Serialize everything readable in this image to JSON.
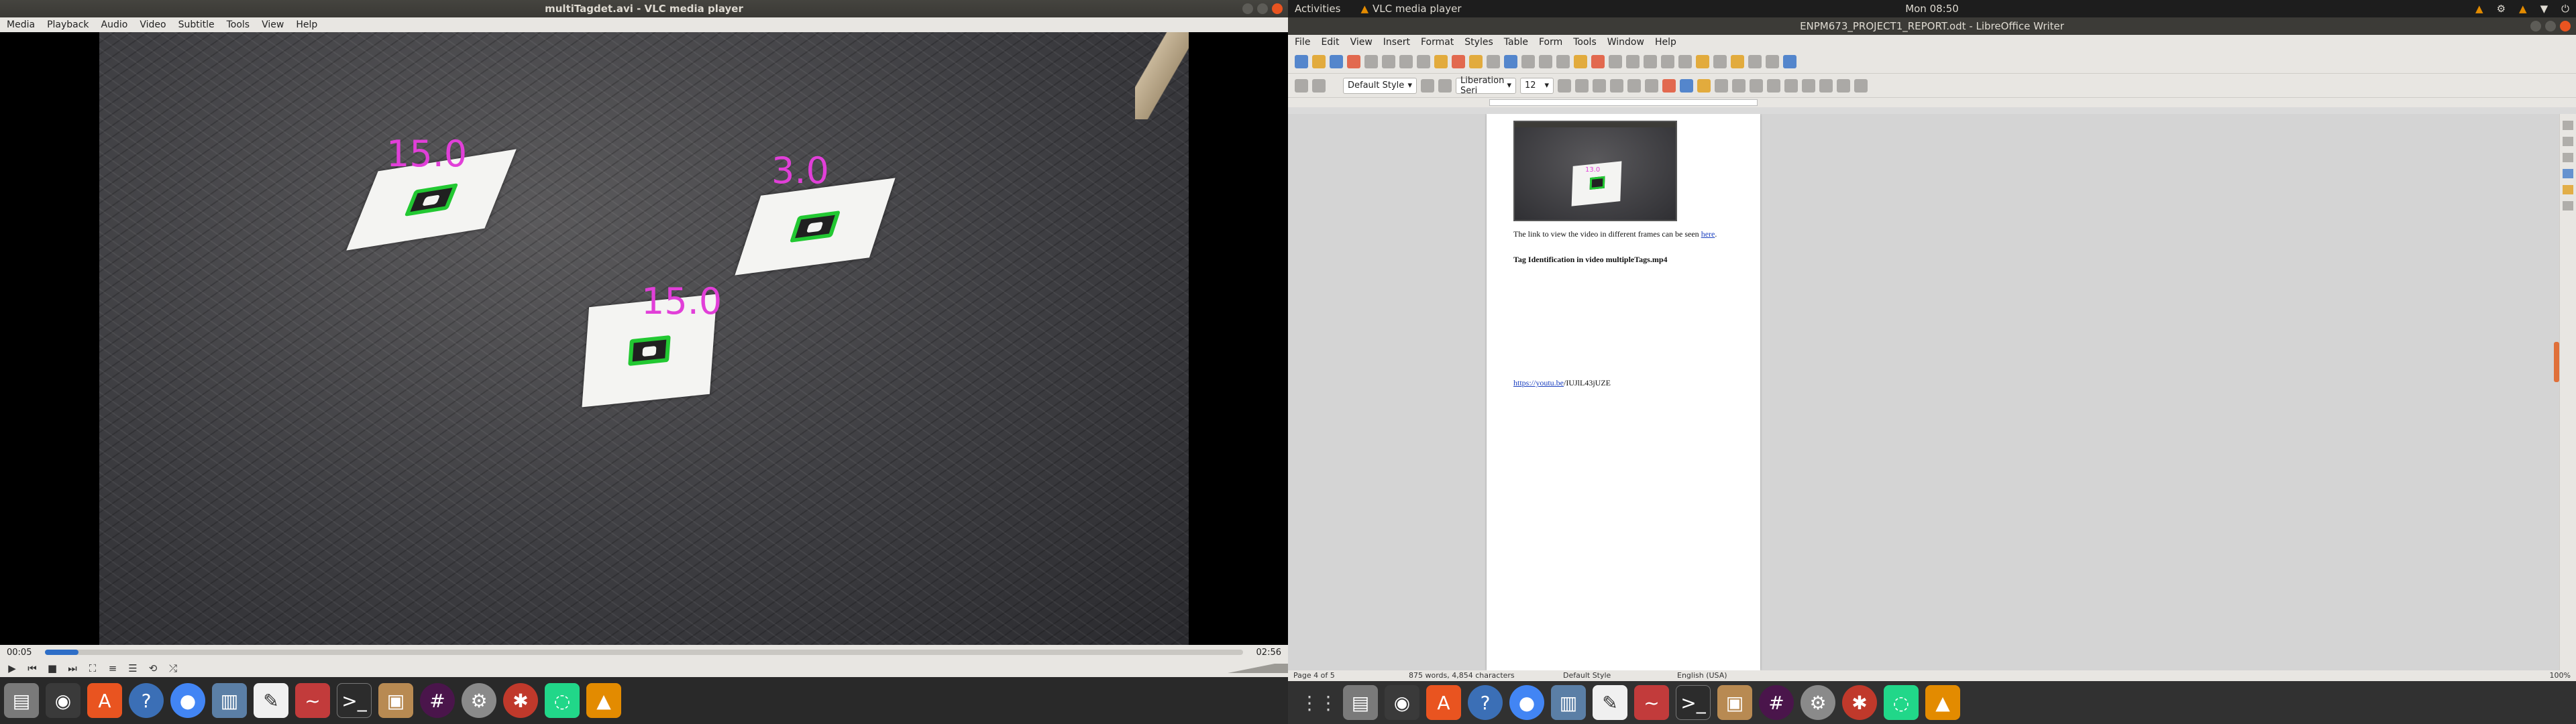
{
  "vlc": {
    "title": "multiTagdet.avi - VLC media player",
    "menu": [
      "Media",
      "Playback",
      "Audio",
      "Video",
      "Subtitle",
      "Tools",
      "View",
      "Help"
    ],
    "tags": [
      "15.0",
      "3.0",
      "15.0"
    ],
    "time_elapsed": "00:05",
    "time_total": "02:56",
    "progress": 0.028
  },
  "right_panel": {
    "activities": "Activities",
    "app_name": "VLC media player",
    "clock": "Mon 08:50"
  },
  "writer": {
    "title": "ENPM673_PROJECT1_REPORT.odt - LibreOffice Writer",
    "menu": [
      "File",
      "Edit",
      "View",
      "Insert",
      "Format",
      "Styles",
      "Table",
      "Form",
      "Tools",
      "Window",
      "Help"
    ],
    "paragraph_style": "Default Style",
    "font_name": "Liberation Seri",
    "font_size": "12",
    "embedded_tag_label": "13.0",
    "text_line1_prefix": "The link to view the video in different frames can be seen ",
    "text_line1_link": "here",
    "heading": "Tag Identification in video multipleTags.mp4",
    "url_prefix": "https://youtu.be",
    "url_suffix": "/IUJlL43jUZE",
    "status_page": "Page 4 of 5",
    "status_words": "875 words, 4,854 characters",
    "status_style": "Default Style",
    "status_lang": "English (USA)",
    "status_zoom": "100%"
  },
  "colors": {
    "tag_label": "#e13fd8",
    "tag_border": "#22c832",
    "accent": "#e95420",
    "link": "#1a3fbf"
  },
  "dock_icons": [
    "files-icon",
    "rhythmbox-icon",
    "software-icon",
    "help-icon",
    "chrome-icon",
    "files-icon",
    "text-editor-icon",
    "libreoffice-icon",
    "terminal-icon",
    "archive-icon",
    "slack-icon",
    "settings-icon",
    "spider-icon",
    "pycharm-icon",
    "vlc-icon"
  ]
}
